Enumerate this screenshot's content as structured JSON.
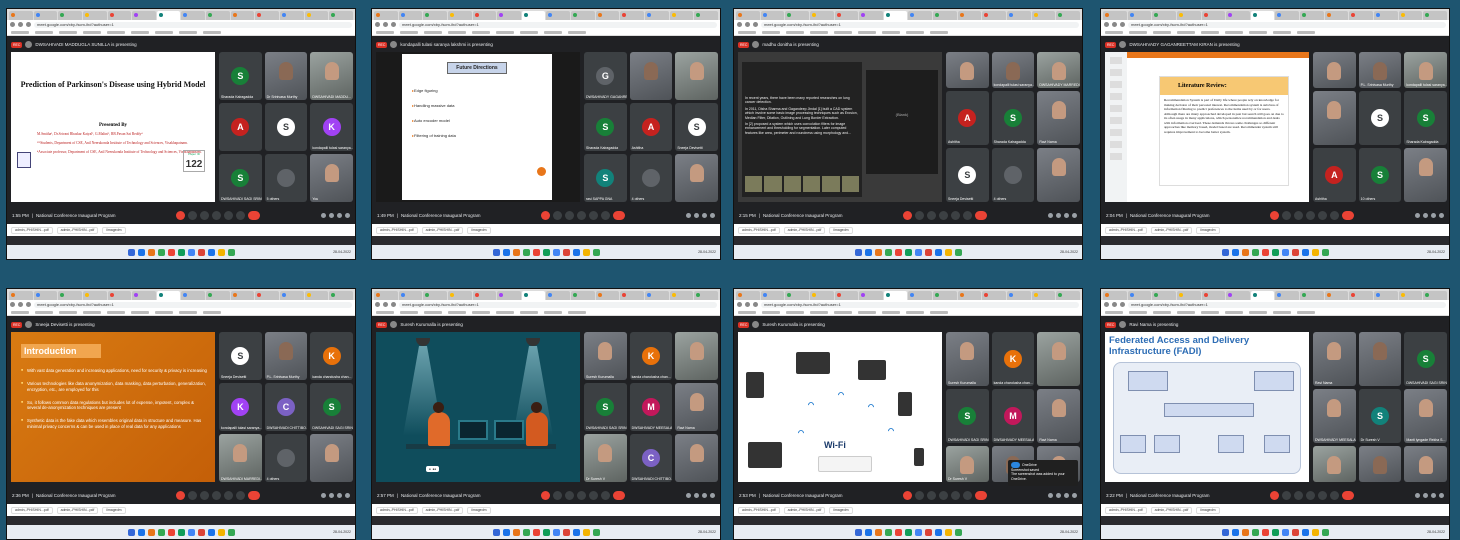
{
  "colors": {
    "page_bg": "#1e5570",
    "meet_bg": "#202124",
    "tile_bg": "#3c4043",
    "end_call": "#ea4335"
  },
  "common": {
    "tab_count": 14,
    "url": "meet.google.com/xby-fscm-ihd?authuser=1",
    "meeting_name": "National Conference Inaugural Program",
    "rec_label": "REC",
    "downloads": [
      "admin,-PHISHIN...pdf",
      "admin,-PHISHIN...pdf",
      "iimagedm"
    ],
    "clock_date": "28-04-2022"
  },
  "screens": [
    {
      "presenter": "DWSAHIVADI MADDUGLA SUNILLA is presenting",
      "time": "1:55 PM",
      "slide": {
        "title": "Prediction of Parkinson's Disease using Hybrid Model",
        "presented_by": "Presented By",
        "authors": [
          "M.Smitha¹, Dr.Srivani Bhaskar Katyal², G.Malini³, RB.Pavan Sai Reddy⁴",
          "¹²³Students, Department of CSE, Anil Neerukonda Institute of Technology and Sciences, Visakhapatnam.",
          "⁴Associate professor, Department of CSE, Anil Neerukonda Institute of Technology and Sciences, Visakhapatnam."
        ],
        "paper_id_label": "Paper ID",
        "paper_id": "122"
      },
      "tiles": [
        {
          "name": "Sharada Kalragadda",
          "initial": "S",
          "color": "#188038"
        },
        {
          "name": "Dr Srinivasa Murthy",
          "cam": true
        },
        {
          "name": "DWSAHIVADI MADDU...",
          "cam": true
        },
        {
          "name": "",
          "initial": "A",
          "color": "#c5221f"
        },
        {
          "name": "",
          "initial": "S",
          "color": "#ffffff"
        },
        {
          "name": "kondapalli tulasi saranya...",
          "initial": "K",
          "color": "#a142f4"
        },
        {
          "name": "DWSAHIVADI SAGI SRINI...",
          "initial": "S",
          "color": "#188038"
        },
        {
          "name": "5 others",
          "initial": "",
          "color": "#5f6368"
        },
        {
          "name": "You",
          "cam": true
        }
      ]
    },
    {
      "presenter": "kondapalli tulasi saranya lakshmi is presenting",
      "time": "1:49 PM",
      "slide": {
        "heading": "Future Directions",
        "items": [
          "Edge figuring",
          "Handling massive data",
          "Auto encoder model",
          "Filtering of training data"
        ]
      },
      "tiles": [
        {
          "name": "DWSAHIVADY GAGANREE...",
          "initial": "G",
          "color": "#5f6368"
        },
        {
          "name": "",
          "cam": true
        },
        {
          "name": "",
          "cam": true
        },
        {
          "name": "Sharada Kalragadda",
          "initial": "S",
          "color": "#188038"
        },
        {
          "name": "Ashitha",
          "initial": "A",
          "color": "#c5221f"
        },
        {
          "name": "Sneeja Devisetti",
          "initial": "S",
          "color": "#ffffff"
        },
        {
          "name": "rasi SAPPA GNA",
          "initial": "S",
          "color": "#12827a"
        },
        {
          "name": "4 others",
          "initial": "",
          "color": "#5f6368"
        },
        {
          "name": "",
          "cam": true
        }
      ]
    },
    {
      "presenter": "madhu donitha is presenting",
      "time": "2:15 PM",
      "slide": {
        "paragraphs": [
          "In recent years, there have been many reported researches on lung cancer detection.",
          "In 2011, Disha Sharma and Gagandeep Jindal [1] built a CAD system which involve some basic image processing techniques such as Erosion, Median Filter, Dilation, Outlining and Lung Border Extraction.",
          "In [2] proposed a system which uses convolution filters for image enhancement and thresholding for segmentation. Later computed features like area, perimeter and roundness using morphology and..."
        ],
        "blank_label": "(Blank)"
      },
      "tiles": [
        {
          "name": "",
          "cam": true
        },
        {
          "name": "kondapalli tulasi saranya...",
          "cam": true
        },
        {
          "name": "DWSAHIVADY MARREDI...",
          "cam": true
        },
        {
          "name": "Ashitha",
          "initial": "A",
          "color": "#c5221f"
        },
        {
          "name": "Sharada Kalragadda",
          "initial": "S",
          "color": "#188038"
        },
        {
          "name": "Ravi Nama",
          "cam": true
        },
        {
          "name": "Sneeja Devisetti",
          "initial": "S",
          "color": "#ffffff"
        },
        {
          "name": "4 others",
          "initial": "",
          "color": "#5f6368"
        },
        {
          "name": "",
          "cam": true
        }
      ]
    },
    {
      "presenter": "DWSAHIVADY GAGANREETTAM KIRAN is presenting",
      "time": "2:04 PM",
      "slide": {
        "heading": "Literature Review:",
        "body": "Recommendation System is part of Daily life where people rely on knowledge for making decision of their personal interest. Recommendation system is subclass of information filtering to predict preferences to the items used by or for users. Although there are many approached developed in past but search still goes on due to its often usage in many applications, which personalize recommendation and deals with information overload. These demands throws some challenges so different approaches like memory based, model based are used. Recommender system still requires improvement to become better system."
      },
      "tiles": [
        {
          "name": "",
          "cam": true
        },
        {
          "name": "P.L. Srinivasa Murthy",
          "cam": true
        },
        {
          "name": "kondapalli tulasi saranya...",
          "cam": true
        },
        {
          "name": "",
          "cam": true
        },
        {
          "name": "",
          "initial": "S",
          "color": "#ffffff"
        },
        {
          "name": "Sharada Kalragadda",
          "initial": "S",
          "color": "#188038"
        },
        {
          "name": "Ashitha",
          "initial": "A",
          "color": "#c5221f"
        },
        {
          "name": "10 others",
          "initial": "S",
          "color": "#188038"
        },
        {
          "name": "",
          "cam": true
        }
      ]
    },
    {
      "presenter": "Sneeja Devisetti is presenting",
      "time": "2:36 PM",
      "slide": {
        "heading": "Introduction",
        "items": [
          "With vast data generation and increasing applications, need for security & privacy is increasing",
          "Various technologies like data anonymization, data masking, data perturbation, generalization, encryption, etc., are employed for this",
          "So, it follows common data regulations but includes lot of expense, impotent, complex & several de-anonymization techniques are present",
          "Synthetic data is the fake data which resembles original data in structure and measure. Has minimal privacy concerns & can be used in place of real data for any applications"
        ]
      },
      "tiles": [
        {
          "name": "Sneeja Devisetti",
          "initial": "S",
          "color": "#ffffff"
        },
        {
          "name": "P.L. Srinivasa Murthy",
          "cam": true
        },
        {
          "name": "kanda chandusha chan...",
          "initial": "K",
          "color": "#e8710a"
        },
        {
          "name": "kondapalli tulasi saranya...",
          "initial": "K",
          "color": "#a142f4"
        },
        {
          "name": "DWSAHIVADI CHITTIBO...",
          "initial": "C",
          "color": "#7b61c4"
        },
        {
          "name": "DWSAHIVADI SAGI SRINI...",
          "initial": "S",
          "color": "#188038"
        },
        {
          "name": "DWSAHIVADI MARREDI...",
          "cam": true
        },
        {
          "name": "4 others",
          "initial": "",
          "color": "#5f6368"
        },
        {
          "name": "",
          "cam": true
        }
      ]
    },
    {
      "presenter": "Suresh Kurumalla is presenting",
      "time": "2:57 PM",
      "slide": {},
      "tiles": [
        {
          "name": "Suresh Kurumalla",
          "cam": true
        },
        {
          "name": "kanda chandusha chan...",
          "initial": "K",
          "color": "#e8710a"
        },
        {
          "name": "",
          "cam": true
        },
        {
          "name": "DWSAHIVADI SAGI SRIN...",
          "initial": "S",
          "color": "#188038"
        },
        {
          "name": "DWSAHIVADY MEESALA...",
          "initial": "M",
          "color": "#c2185b"
        },
        {
          "name": "Ravi Nama",
          "cam": true
        },
        {
          "name": "Dr Suresh V",
          "cam": true
        },
        {
          "name": "DWSAHIVADI CHITTIBO...",
          "initial": "C",
          "color": "#7b61c4"
        },
        {
          "name": "",
          "cam": true
        }
      ]
    },
    {
      "presenter": "Suresh Kurumalla is presenting",
      "time": "2:53 PM",
      "slide": {
        "wifi_label": "Wi-Fi"
      },
      "toast": {
        "app": "OneDrive",
        "title": "Screenshot saved",
        "body": "The screenshot was added to your OneDrive."
      },
      "tiles": [
        {
          "name": "Suresh Kurumalla",
          "cam": true
        },
        {
          "name": "kanda chandusha chan...",
          "initial": "K",
          "color": "#e8710a"
        },
        {
          "name": "",
          "cam": true
        },
        {
          "name": "DWSAHIVADI SAGI SRIN...",
          "initial": "S",
          "color": "#188038"
        },
        {
          "name": "DWSAHIVADY MEESALA...",
          "initial": "M",
          "color": "#c2185b"
        },
        {
          "name": "Ravi Nama",
          "cam": true
        },
        {
          "name": "Dr Suresh V",
          "cam": true
        },
        {
          "name": "",
          "cam": true
        },
        {
          "name": "",
          "cam": true
        }
      ]
    },
    {
      "presenter": "Ravi Nama is presenting",
      "time": "3:22 PM",
      "slide": {
        "heading": "Federated Access and Delivery Infrastructure (FADI)"
      },
      "tiles": [
        {
          "name": "Ravi Nama",
          "cam": true
        },
        {
          "name": "",
          "cam": true
        },
        {
          "name": "DWSAHIVADI SAGI SRIN...",
          "initial": "S",
          "color": "#188038"
        },
        {
          "name": "DWSAHIVADY MEESALA...",
          "cam": true
        },
        {
          "name": "Dr Suresh V",
          "initial": "S",
          "color": "#12827a"
        },
        {
          "name": "Manti lyngade Rekha S...",
          "cam": true
        },
        {
          "name": "",
          "cam": true
        },
        {
          "name": "",
          "cam": true
        },
        {
          "name": "",
          "cam": true
        }
      ]
    }
  ]
}
